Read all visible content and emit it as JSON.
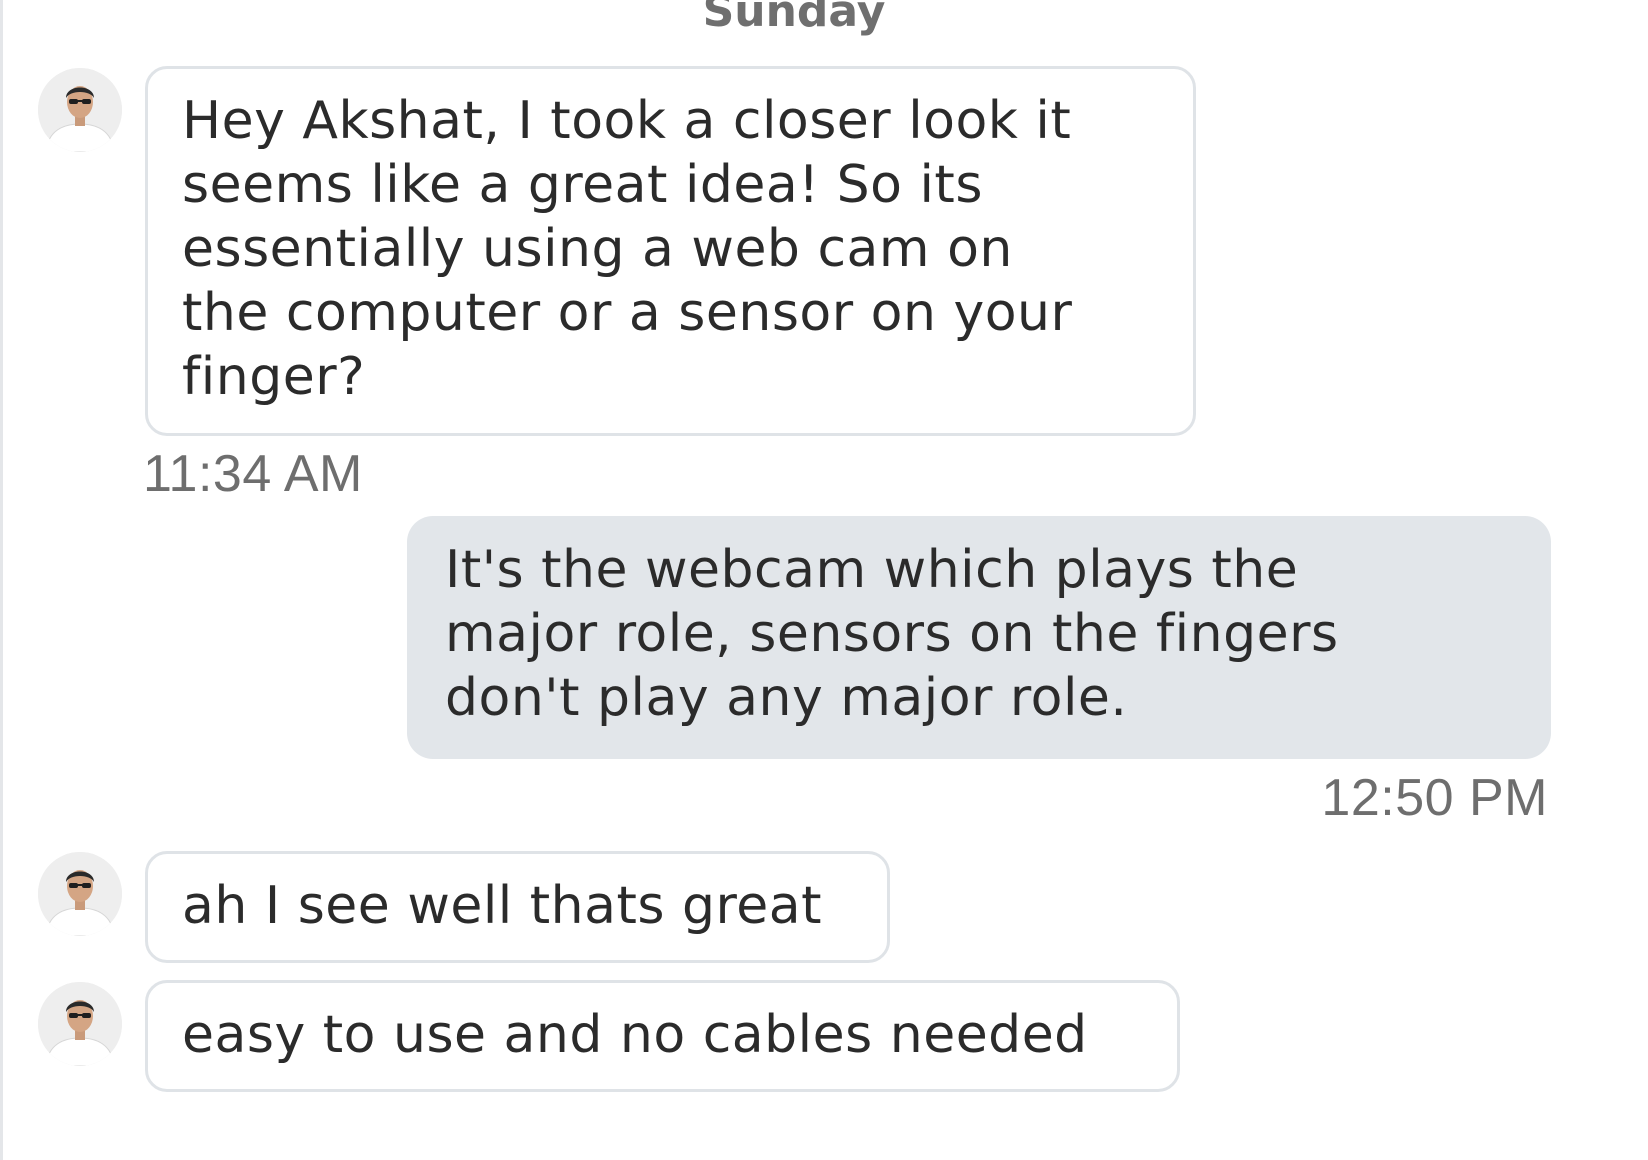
{
  "conversation": {
    "date_label": "Sunday",
    "messages": [
      {
        "direction": "incoming",
        "lines": [
          "Hey Akshat, I took a closer look it",
          "seems like a great idea! So its",
          "essentially using a web cam on",
          "the computer or a sensor on your",
          "finger?"
        ],
        "time": "11:34 AM"
      },
      {
        "direction": "outgoing",
        "lines": [
          "It's the webcam which plays the",
          "major role, sensors on the fingers",
          "don't play any major role."
        ],
        "time": "12:50 PM"
      },
      {
        "direction": "incoming",
        "lines": [
          "ah I see well thats great"
        ]
      },
      {
        "direction": "incoming",
        "lines": [
          "easy to use and no cables needed"
        ]
      }
    ]
  }
}
